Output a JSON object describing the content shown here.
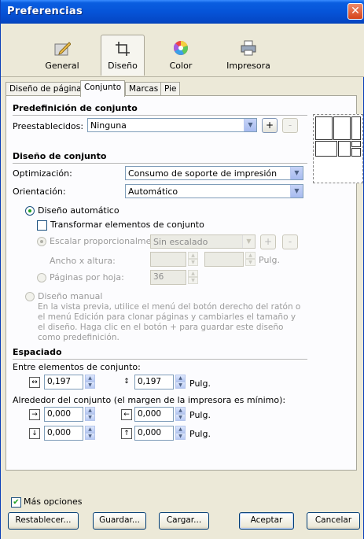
{
  "window": {
    "title": "Preferencias"
  },
  "toolbar": {
    "items": [
      {
        "label": "General",
        "icon": "general-pencil-icon"
      },
      {
        "label": "Diseño",
        "icon": "layout-crop-icon"
      },
      {
        "label": "Color",
        "icon": "color-wheel-icon"
      },
      {
        "label": "Impresora",
        "icon": "printer-icon"
      }
    ],
    "selected": "Diseño"
  },
  "tabs": [
    {
      "label": "Diseño de página"
    },
    {
      "label": "Conjunto"
    },
    {
      "label": "Marcas"
    },
    {
      "label": "Pie"
    }
  ],
  "active_tab": "Conjunto",
  "preset_section": {
    "title": "Predefinición de conjunto",
    "label": "Preestablecidos:",
    "value": "Ninguna",
    "add": "+",
    "remove": "-"
  },
  "layout_section": {
    "title": "Diseño de conjunto",
    "optimization_label": "Optimización:",
    "optimization_value": "Consumo de soporte de impresión",
    "orientation_label": "Orientación:",
    "orientation_value": "Automático",
    "auto_layout": "Diseño automático",
    "transform_elements": "Transformar elementos de conjunto",
    "scale_label": "Escalar proporcionalmente:",
    "scale_value": "Sin escalado",
    "width_height_label": "Ancho x altura:",
    "unit": "Pulg.",
    "pages_per_sheet_label": "Páginas por hoja:",
    "pages_per_sheet_value": "36",
    "manual_layout": "Diseño manual",
    "manual_desc": "En la vista previa, utilice el menú del botón derecho del ratón o el menú Edición para clonar páginas y cambiarles el tamaño y el diseño. Haga clic en el botón + para guardar este diseño como predefinición."
  },
  "spacing_section": {
    "title": "Espaciado",
    "between_label": "Entre elementos de conjunto:",
    "between_h": "0,197",
    "between_v": "0,197",
    "unit": "Pulg.",
    "around_label": "Alrededor del conjunto (el margen de la impresora es mínimo):",
    "top": "0,000",
    "right": "0,000",
    "bottom": "0,000",
    "left": "0,000"
  },
  "more_options": {
    "label": "Más opciones",
    "checked": true
  },
  "buttons": {
    "reset": "Restablecer...",
    "save": "Guardar...",
    "load": "Cargar...",
    "ok": "Aceptar",
    "cancel": "Cancelar"
  },
  "colors": {
    "titlebar": "#0654d8",
    "check": "#21a121",
    "accent_border": "#003c74"
  }
}
